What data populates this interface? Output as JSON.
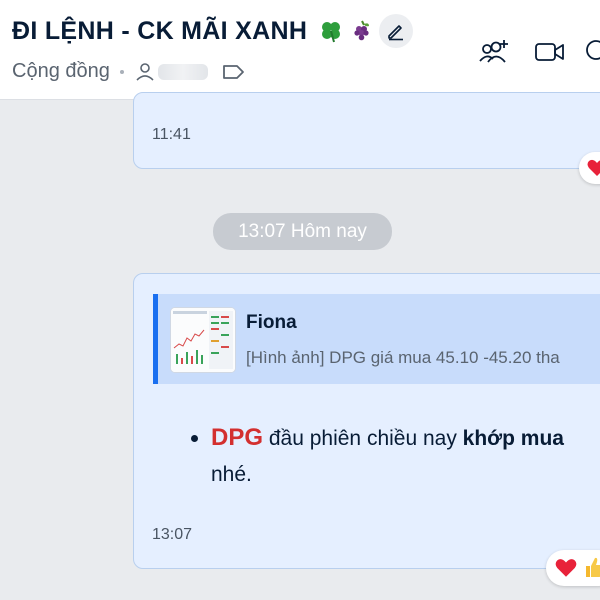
{
  "header": {
    "title": "ĐI LỆNH - CK MÃI XANH",
    "title_emojis": [
      "four-leaf-clover",
      "grapes"
    ],
    "community_label": "Cộng đồng",
    "actions": [
      "add-member-icon",
      "video-call-icon",
      "search-icon"
    ]
  },
  "messages": {
    "previous": {
      "time": "11:41",
      "reactions": [
        "heart"
      ]
    },
    "date_separator": "13:07 Hôm nay",
    "current": {
      "quote": {
        "author": "Fiona",
        "preview": "[Hình ảnh] DPG giá mua 45.10 -45.20 tha"
      },
      "ticker": "DPG",
      "text_part1": " đầu phiên chiều nay ",
      "text_bold": "khớp mua",
      "text_part2": "nhé.",
      "time": "13:07",
      "reactions": [
        "heart",
        "thumbs-up"
      ]
    }
  },
  "colors": {
    "accent": "#1a6ff0",
    "bubble": "#e5efff",
    "ticker": "#d32f2f"
  }
}
